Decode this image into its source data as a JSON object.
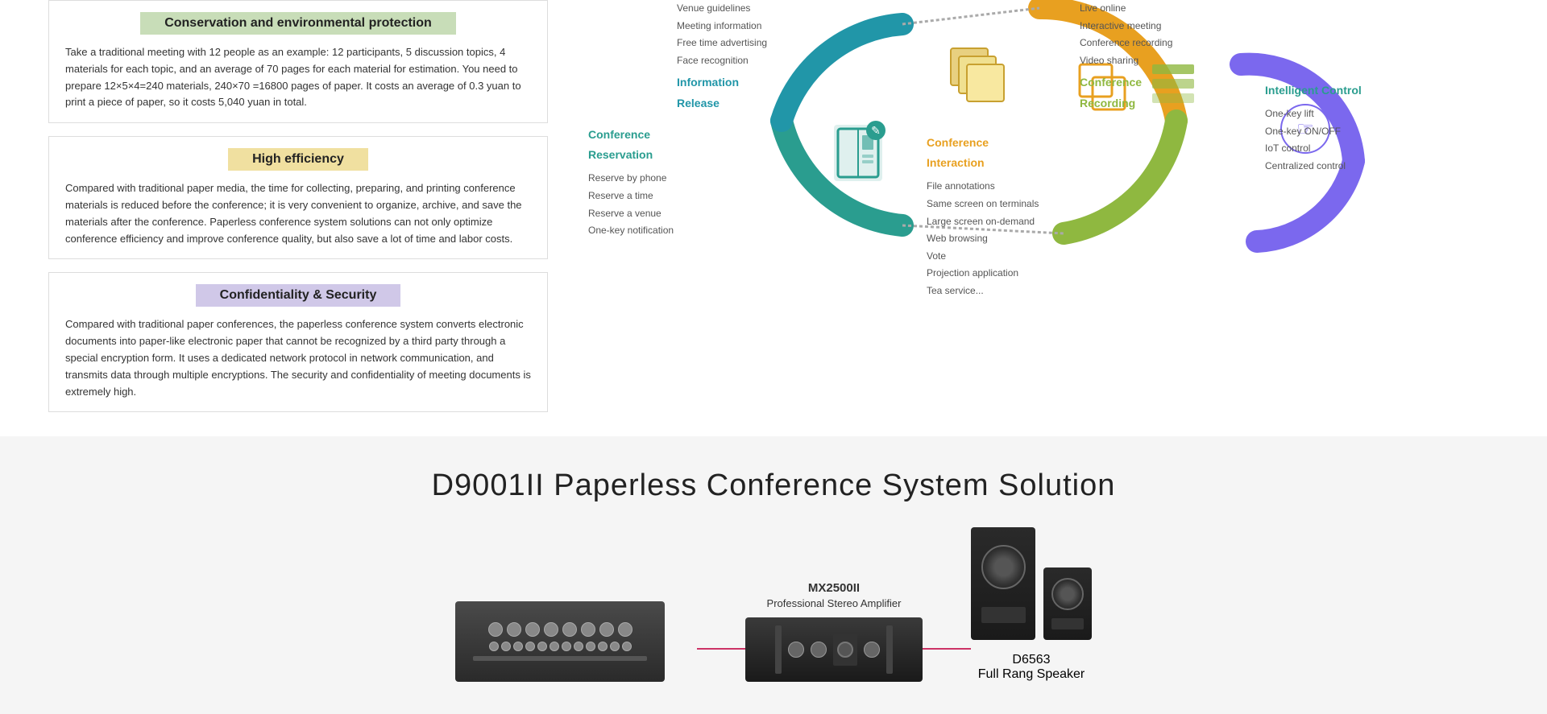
{
  "left": {
    "boxes": [
      {
        "id": "doc-management",
        "title": "Conservation and environmental protection",
        "title_class": "green",
        "body": "Take a traditional meeting with 12 people as an example: 12 participants, 5 discussion topics, 4 materials for each topic, and an average of 70 pages for each material for estimation. You need to prepare 12×5×4=240 materials, 240×70 =16800 pages of paper. It costs an average of 0.3 yuan to print a piece of paper, so it costs 5,040 yuan in total."
      },
      {
        "id": "high-efficiency",
        "title": "High efficiency",
        "title_class": "yellow",
        "body": "Compared with traditional paper media, the time for collecting, preparing, and printing conference materials is reduced before the conference; it is very convenient to organize, archive, and save the materials after the conference. Paperless conference system solutions can not only optimize conference efficiency and improve conference quality, but also save a lot of time and labor costs."
      },
      {
        "id": "confidentiality",
        "title": "Confidentiality & Security",
        "title_class": "purple",
        "body": "Compared with traditional paper conferences, the paperless conference system converts electronic documents into paper-like electronic paper that cannot be recognized by a third party through a special encryption form. It uses a dedicated network protocol in network communication, and transmits data through multiple encryptions. The security and confidentiality of meeting documents is extremely high."
      }
    ]
  },
  "diagram": {
    "sections": {
      "conference_reservation": {
        "title": "Conference\nReservation",
        "color": "teal",
        "items": [
          "Reserve by phone",
          "Reserve a time",
          "Reserve a venue",
          "One-key notification"
        ]
      },
      "information_release": {
        "title": "Information\nRelease",
        "color": "blue",
        "items": [
          "Venue guidelines",
          "Meeting information",
          "Free time advertising",
          "Face recognition"
        ]
      },
      "conference_interaction": {
        "title": "Conference\nInteraction",
        "color": "orange",
        "items": [
          "File annotations",
          "Same screen on terminals",
          "Large screen on-demand",
          "Web browsing",
          "Vote",
          "Projection application",
          "Tea service..."
        ]
      },
      "conference_recording": {
        "title": "Conference\nRecording",
        "color": "green",
        "items": [
          "Live online",
          "Interactive meeting",
          "Conference recording",
          "Video sharing"
        ]
      },
      "intelligent_control": {
        "title": "Intelligent Control",
        "color": "teal",
        "items": [
          "One-key lift",
          "One-key ON/OFF",
          "IoT control",
          "Centralized control"
        ]
      }
    }
  },
  "bottom": {
    "title": "D9001II Paperless Conference System Solution",
    "equipment": [
      {
        "id": "mixer",
        "model": "",
        "name": ""
      },
      {
        "id": "amplifier",
        "model": "MX2500II",
        "name": "Professional Stereo Amplifier"
      },
      {
        "id": "speaker-main",
        "model": "D6563",
        "name": "Full Rang Speaker"
      }
    ]
  }
}
